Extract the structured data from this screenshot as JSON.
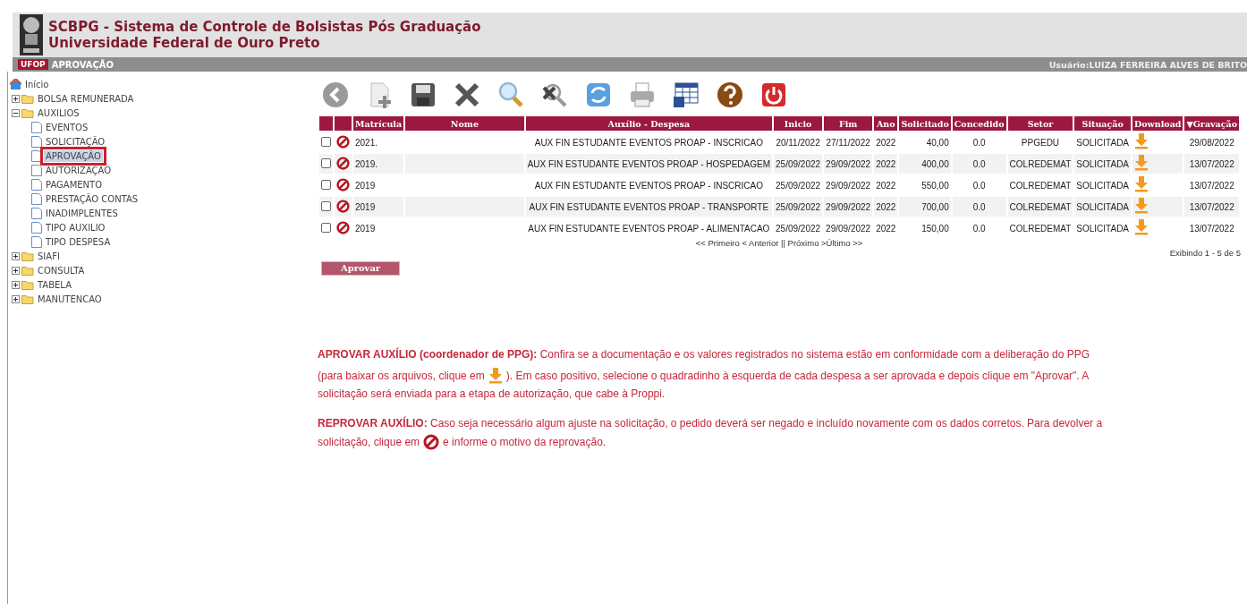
{
  "header": {
    "title": "SCBPG - Sistema de Controle de Bolsistas Pós Graduação",
    "subtitle": "Universidade Federal de Ouro Preto"
  },
  "bar": {
    "badge": "UFOP",
    "page_title": "APROVAÇÃO",
    "user": "Usuário:LUIZA FERREIRA ALVES DE BRITO"
  },
  "sidebar": {
    "home": "Início",
    "items": [
      {
        "label": "BOLSA REMUNERADA",
        "expanded": false
      },
      {
        "label": "AUXILIOS",
        "expanded": true,
        "children": [
          {
            "label": "EVENTOS",
            "selected": false
          },
          {
            "label": "SOLICITAÇÃO",
            "selected": false
          },
          {
            "label": "APROVAÇÃO",
            "selected": true
          },
          {
            "label": "AUTORIZAÇÃO",
            "selected": false
          },
          {
            "label": "PAGAMENTO",
            "selected": false
          },
          {
            "label": "PRESTAÇÃO CONTAS",
            "selected": false
          },
          {
            "label": "INADIMPLENTES",
            "selected": false
          },
          {
            "label": "TIPO AUXILIO",
            "selected": false
          },
          {
            "label": "TIPO DESPESA",
            "selected": false
          }
        ]
      },
      {
        "label": "SIAFI",
        "expanded": false
      },
      {
        "label": "CONSULTA",
        "expanded": false
      },
      {
        "label": "TABELA",
        "expanded": false
      },
      {
        "label": "MANUTENCAO",
        "expanded": false
      }
    ]
  },
  "toolbar": [
    {
      "kind": "back"
    },
    {
      "kind": "new"
    },
    {
      "kind": "save"
    },
    {
      "kind": "delete"
    },
    {
      "kind": "search"
    },
    {
      "kind": "clear-search"
    },
    {
      "kind": "refresh"
    },
    {
      "kind": "print"
    },
    {
      "kind": "export"
    },
    {
      "kind": "help"
    },
    {
      "kind": "exit"
    }
  ],
  "table": {
    "columns": [
      "Matrícula",
      "Nome",
      "Auxílio - Despesa",
      "Inicio",
      "Fim",
      "Ano",
      "Solicitado",
      "Concedido",
      "Setor",
      "Situação",
      "Download",
      "▼Gravação"
    ],
    "rows": [
      {
        "checked": false,
        "matricula": "2021.",
        "despesa": "AUX FIN ESTUDANTE EVENTOS PROAP - INSCRICAO",
        "inicio": "20/11/2022",
        "fim": "27/11/2022",
        "ano": "2022",
        "solicitado": "40,00",
        "concedido": "0.0",
        "setor": "PPGEDU",
        "situacao": "SOLICITADA",
        "gravacao": "29/08/2022"
      },
      {
        "checked": false,
        "matricula": "2019.",
        "despesa": "AUX FIN ESTUDANTE EVENTOS PROAP - HOSPEDAGEM",
        "inicio": "25/09/2022",
        "fim": "29/09/2022",
        "ano": "2022",
        "solicitado": "400,00",
        "concedido": "0.0",
        "setor": "COLREDEMAT",
        "situacao": "SOLICITADA",
        "gravacao": "13/07/2022"
      },
      {
        "checked": false,
        "matricula": "2019",
        "despesa": "AUX FIN ESTUDANTE EVENTOS PROAP - INSCRICAO",
        "inicio": "25/09/2022",
        "fim": "29/09/2022",
        "ano": "2022",
        "solicitado": "550,00",
        "concedido": "0.0",
        "setor": "COLREDEMAT",
        "situacao": "SOLICITADA",
        "gravacao": "13/07/2022"
      },
      {
        "checked": false,
        "matricula": "2019",
        "despesa": "AUX FIN ESTUDANTE EVENTOS PROAP - TRANSPORTE",
        "inicio": "25/09/2022",
        "fim": "29/09/2022",
        "ano": "2022",
        "solicitado": "700,00",
        "concedido": "0.0",
        "setor": "COLREDEMAT",
        "situacao": "SOLICITADA",
        "gravacao": "13/07/2022"
      },
      {
        "checked": false,
        "matricula": "2019",
        "despesa": "AUX FIN ESTUDANTE EVENTOS PROAP - ALIMENTACAO",
        "inicio": "25/09/2022",
        "fim": "29/09/2022",
        "ano": "2022",
        "solicitado": "150,00",
        "concedido": "0.0",
        "setor": "COLREDEMAT",
        "situacao": "SOLICITADA",
        "gravacao": "13/07/2022"
      }
    ]
  },
  "pager": "<< Primeiro < Anterior || Próximo >Último >>",
  "count": "Exibindo 1 - 5 de 5",
  "approve_button": "Aprovar",
  "help": [
    [
      [
        {
          "kind": "text",
          "text": "**APROVAR AUXÍLIO (coordenador de PPG):** Confira se a documentação e os valores registrados no sistema estão em conformidade com a deliberação do PPG"
        }
      ],
      [
        {
          "kind": "text",
          "text": "(para baixar os arquivos, clique em"
        },
        {
          "kind": "download"
        },
        {
          "kind": "text",
          "text": "). Em caso positivo, selecione o quadradinho à esquerda de cada despesa a ser aprovada e depois clique em \"Aprovar\". A"
        }
      ],
      [
        {
          "kind": "text",
          "text": "solicitação será enviada para a etapa de autorização, que cabe à Proppi."
        }
      ]
    ],
    [
      [
        {
          "kind": "text",
          "text": "**REPROVAR AUXÍLIO:** Caso seja necessário algum ajuste na solicitação, o pedido deverá ser negado e incluído novamente com os dados corretos. Para devolver a"
        }
      ],
      [
        {
          "kind": "text",
          "text": "solicitação, clique em"
        },
        {
          "kind": "reject"
        },
        {
          "kind": "text",
          "text": "e informe o motivo da reprovação."
        }
      ]
    ]
  ]
}
